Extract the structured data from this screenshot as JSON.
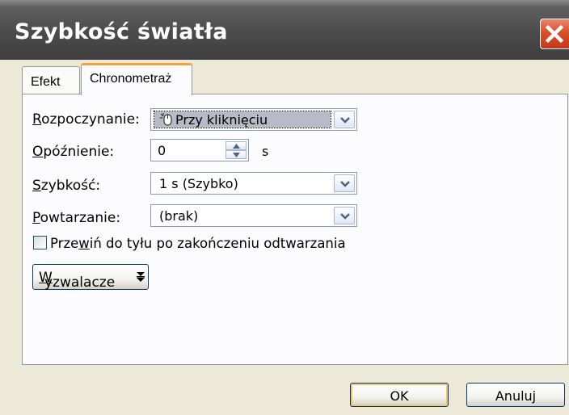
{
  "window": {
    "title": "Szybkość światła"
  },
  "tabs": [
    {
      "label": "Efekt",
      "active": false
    },
    {
      "label": "Chronometraż",
      "active": true
    }
  ],
  "form": {
    "start": {
      "label_underline": "R",
      "label_rest": "ozpoczynanie:",
      "value": "Przy kliknięciu",
      "icon": "mouse-click-icon"
    },
    "delay": {
      "label_underline": "O",
      "label_rest": "późnienie:",
      "value": "0",
      "unit": "s"
    },
    "speed": {
      "label_underline": "S",
      "label_rest": "zybkość:",
      "value": "1 s (Szybko)"
    },
    "repeat": {
      "label_underline": "P",
      "label_rest": "owtarzanie:",
      "value": "(brak)"
    },
    "rewind": {
      "label_before": "Prze",
      "label_underline": "w",
      "label_after": "iń do tyłu po zakończeniu odtwarzania",
      "checked": false
    },
    "triggers": {
      "label_underline": "W",
      "label_rest": "yzwalacze"
    }
  },
  "footer": {
    "ok_label": "OK",
    "cancel_label": "Anuluj"
  },
  "colors": {
    "close": "#d8502b",
    "active_tab_accent": "#f2a33a",
    "titlebar": "#4b4b4b"
  }
}
